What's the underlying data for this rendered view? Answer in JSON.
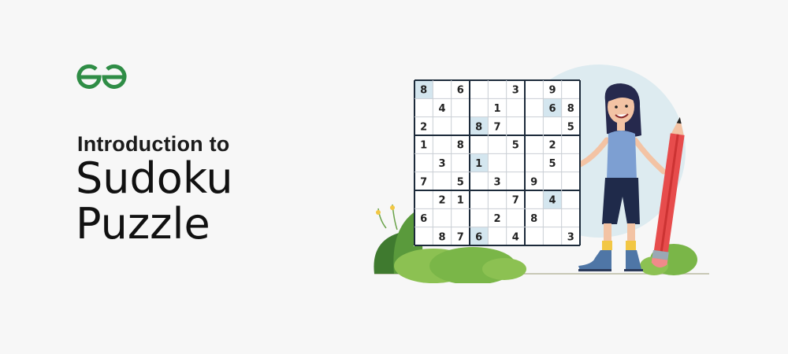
{
  "brand": {
    "logo_text": "GG",
    "accent_color": "#2f8d46"
  },
  "heading": {
    "subtitle": "Introduction to",
    "title_line1": "Sudoku",
    "title_line2": "Puzzle"
  },
  "sudoku": {
    "grid": [
      [
        8,
        0,
        6,
        0,
        0,
        3,
        0,
        9,
        0
      ],
      [
        0,
        4,
        0,
        0,
        1,
        0,
        0,
        6,
        8
      ],
      [
        2,
        0,
        0,
        8,
        7,
        0,
        0,
        0,
        5
      ],
      [
        1,
        0,
        8,
        0,
        0,
        5,
        0,
        2,
        0
      ],
      [
        0,
        3,
        0,
        1,
        0,
        0,
        0,
        5,
        0
      ],
      [
        7,
        0,
        5,
        0,
        3,
        0,
        9,
        0,
        0
      ],
      [
        0,
        2,
        1,
        0,
        0,
        7,
        0,
        4,
        0
      ],
      [
        6,
        0,
        0,
        0,
        2,
        0,
        8,
        0,
        0
      ],
      [
        0,
        8,
        7,
        6,
        0,
        4,
        0,
        0,
        3
      ]
    ],
    "highlighted_cells": [
      [
        0,
        0
      ],
      [
        1,
        7
      ],
      [
        2,
        3
      ],
      [
        4,
        3
      ],
      [
        6,
        7
      ],
      [
        8,
        3
      ]
    ],
    "highlight_color": "#d4e6ef"
  },
  "illustration": {
    "girl_icon": "girl-character-icon",
    "pencil_icon": "pencil-icon",
    "bush_icon": "bush-icon",
    "circle_color": "#ddebf0"
  }
}
